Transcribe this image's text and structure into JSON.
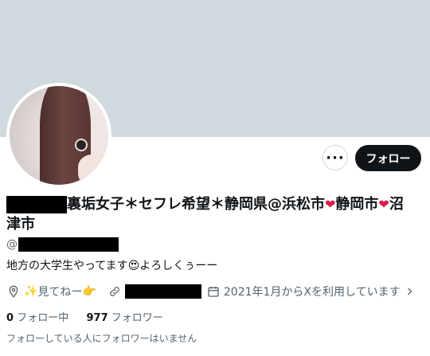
{
  "profile": {
    "display_name_parts": [
      "裏垢女子＊セフレ希望＊静岡県@浜松市",
      "静岡市",
      "沼",
      "津市"
    ],
    "handle_prefix": "@",
    "bio_start": "地方の大学生やってます",
    "bio_emoji": "😍",
    "bio_end": "よろしくぅーー",
    "location_sparkle": "✨",
    "location_text": "見てねー",
    "location_pointing": "👉",
    "joined": "2021年1月からXを利用しています",
    "following_count": "0",
    "following_label": "フォロー中",
    "followers_count": "977",
    "followers_label": "フォロワー",
    "followers_note": "フォローしている人にフォロワーはいません"
  },
  "actions": {
    "more_label": "···",
    "follow_label": "フォロー"
  },
  "icons": {
    "heart": "❤",
    "location": "location-pin-icon",
    "link": "link-icon",
    "calendar": "calendar-icon",
    "chevron": "chevron-right-icon"
  }
}
